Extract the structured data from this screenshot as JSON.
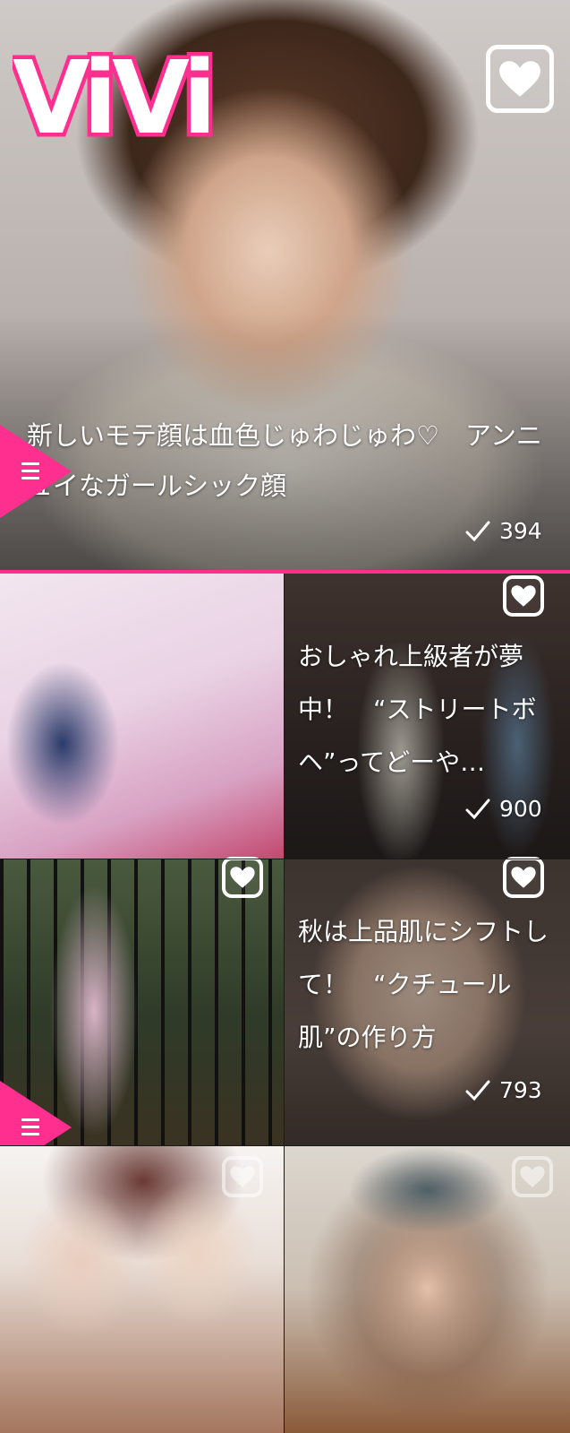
{
  "brand": {
    "logo_text": "ViVi",
    "accent_color": "#ff2f8f"
  },
  "hero": {
    "title": "新しいモテ顔は血色じゅわじゅわ♡　アンニュイなガールシック顔",
    "count": "394",
    "heart_icon": "heart-icon",
    "check_icon": "check-icon"
  },
  "tiles": [
    {
      "title": "",
      "count": ""
    },
    {
      "title": "おしゃれ上級者が夢中！　“ストリートボヘ”ってどーや…",
      "count": "900"
    },
    {
      "title": "",
      "count": ""
    },
    {
      "title": "秋は上品肌にシフトして！　“クチュール肌”の作り方",
      "count": "793"
    },
    {
      "title": "",
      "count": ""
    },
    {
      "title": "",
      "count": ""
    }
  ],
  "menu_icon": "hamburger-menu-icon"
}
